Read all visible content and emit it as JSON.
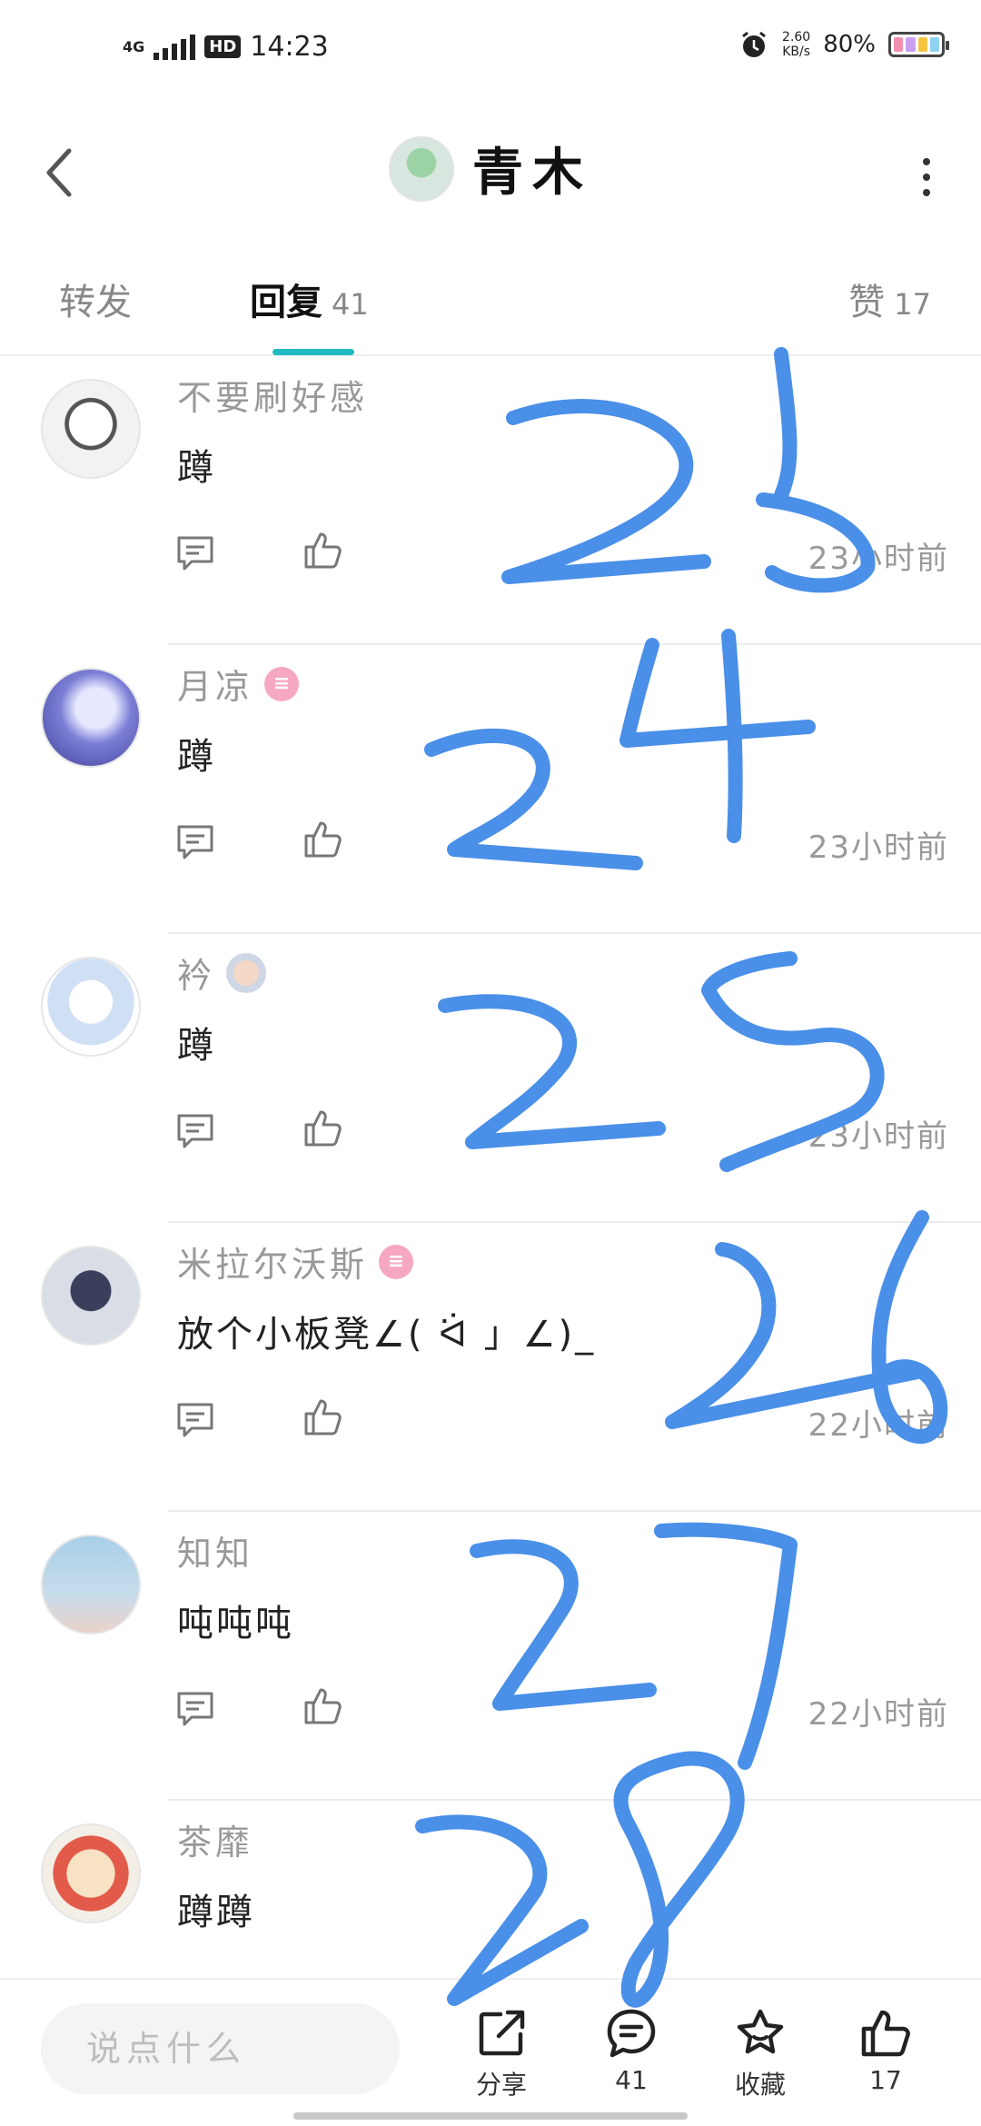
{
  "status_bar": {
    "network": "4G",
    "hd": "HD",
    "time": "14:23",
    "speed_value": "2.60",
    "speed_unit": "KB/s",
    "battery": "80%",
    "battery_colors": [
      "#f28fb0",
      "#c9a0f0",
      "#f5c542",
      "#8fd1f0"
    ]
  },
  "header": {
    "back_icon": "chevron-left-icon",
    "title": "青木",
    "more_icon": "more-vertical-icon"
  },
  "tabs": [
    {
      "label": "转发",
      "count": ""
    },
    {
      "label": "回复",
      "count": "41"
    },
    {
      "label": "赞",
      "count": "17"
    }
  ],
  "accent_color": "#22b9c4",
  "comments": [
    {
      "name": "不要刷好感",
      "text": "蹲",
      "time": "23小时前",
      "badge": ""
    },
    {
      "name": "月凉",
      "text": "蹲",
      "time": "23小时前",
      "badge": "level"
    },
    {
      "name": "衿",
      "text": "蹲",
      "time": "23小时前",
      "badge": "sticker"
    },
    {
      "name": "米拉尔沃斯",
      "text": "放个小板凳∠( ᐛ 」∠)_",
      "time": "22小时前",
      "badge": "level"
    },
    {
      "name": "知知",
      "text": "吨吨吨",
      "time": "22小时前",
      "badge": ""
    },
    {
      "name": "茶靡",
      "text": "蹲蹲",
      "time": "",
      "badge": ""
    }
  ],
  "bottom_bar": {
    "input_placeholder": "说点什么",
    "share_label": "分享",
    "comment_count": "41",
    "favorite_label": "收藏",
    "like_count": "17"
  },
  "handwriting": {
    "color": "#4a8fe8",
    "numbers": [
      "23",
      "24",
      "25",
      "26",
      "27",
      "28"
    ]
  }
}
